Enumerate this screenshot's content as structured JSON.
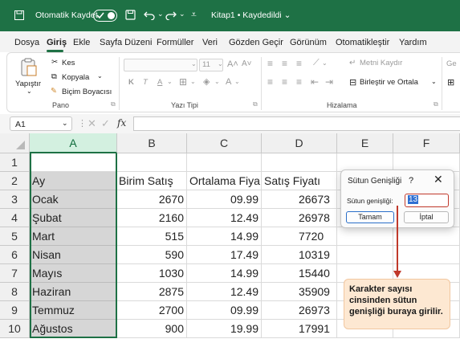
{
  "titlebar": {
    "autosave_label": "Otomatik Kaydet",
    "file_title": "Kitap1 • Kaydedildi ⌄"
  },
  "menu": [
    "Dosya",
    "Giriş",
    "Ekle",
    "Sayfa Düzeni",
    "Formüller",
    "Veri",
    "Gözden Geçir",
    "Görünüm",
    "Otomatikleştir",
    "Yardım"
  ],
  "ribbon": {
    "paste": "Yapıştır",
    "cut": "Kes",
    "copy": "Kopyala",
    "format_painter": "Biçim Boyacısı",
    "group_clipboard": "Pano",
    "font_size": "11",
    "bold": "K",
    "italic": "T",
    "underline": "A",
    "group_font": "Yazı Tipi",
    "wrap_text": "Metni Kaydır",
    "merge_center": "Birleştir ve Ortala",
    "group_alignment": "Hizalama",
    "overflow": "Ge"
  },
  "formula_bar": {
    "name_box": "A1",
    "fx": "fx"
  },
  "sheet": {
    "columns": [
      "A",
      "B",
      "C",
      "D",
      "E",
      "F"
    ],
    "rows": [
      [
        "",
        "",
        "",
        ""
      ],
      [
        "Ay",
        "Birim Satış",
        "Ortalama Fiya",
        "Satış Fiyatı"
      ],
      [
        "Ocak",
        "2670",
        "09.99",
        "26673"
      ],
      [
        "Şubat",
        "2160",
        "12.49",
        "26978"
      ],
      [
        "Mart",
        "515",
        "14.99",
        "7720"
      ],
      [
        "Nisan",
        "590",
        "17.49",
        "10319"
      ],
      [
        "Mayıs",
        "1030",
        "14.99",
        "15440"
      ],
      [
        "Haziran",
        "2875",
        "12.49",
        "35909"
      ],
      [
        "Temmuz",
        "2700",
        "09.99",
        "26973"
      ],
      [
        "Ağustos",
        "900",
        "19.99",
        "17991"
      ]
    ]
  },
  "dialog": {
    "title": "Sütun Genişliği",
    "help": "?",
    "close": "✕",
    "field_label": "Sütun genişliği:",
    "field_value": "13",
    "ok": "Tamam",
    "cancel": "İptal"
  },
  "callout": {
    "text": "Karakter sayısı cinsinden sütun genişliği buraya girilir."
  },
  "colors": {
    "excel_green": "#1e7145",
    "callout_fill": "#fde8d2",
    "arrow_red": "#c0392b"
  }
}
